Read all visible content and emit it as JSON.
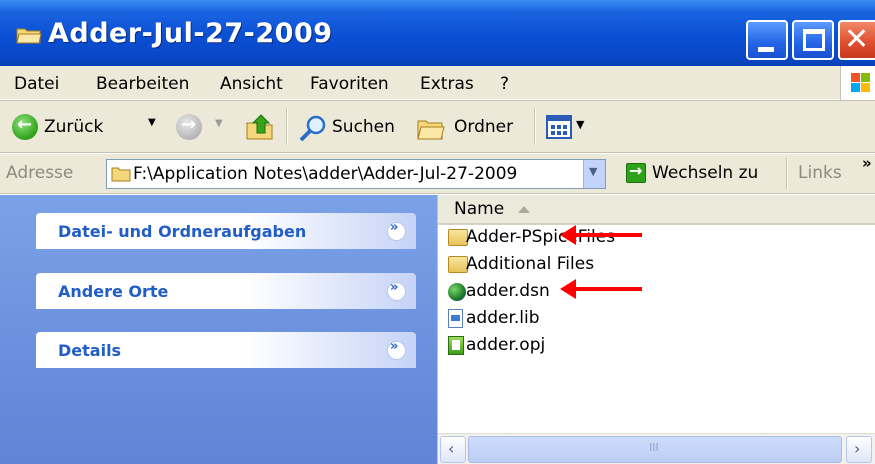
{
  "window": {
    "title": "Adder-Jul-27-2009"
  },
  "menubar": {
    "items": [
      "Datei",
      "Bearbeiten",
      "Ansicht",
      "Favoriten",
      "Extras",
      "?"
    ]
  },
  "toolbar": {
    "back_label": "Zurück",
    "search_label": "Suchen",
    "folders_label": "Ordner"
  },
  "addressbar": {
    "label": "Adresse",
    "path": "F:\\Application Notes\\adder\\Adder-Jul-27-2009",
    "go_label": "Wechseln zu",
    "links_label": "Links",
    "overflow": "»"
  },
  "taskpane": {
    "sections": [
      {
        "label": "Datei- und Ordneraufgaben"
      },
      {
        "label": "Andere Orte"
      },
      {
        "label": "Details"
      }
    ]
  },
  "filelist": {
    "column_header": "Name",
    "items": [
      {
        "name": "Adder-PSpiceFiles",
        "icon": "folder-icon",
        "highlighted": true
      },
      {
        "name": "Additional Files",
        "icon": "folder-icon",
        "highlighted": false
      },
      {
        "name": "adder.dsn",
        "icon": "design-file-icon",
        "highlighted": true
      },
      {
        "name": "adder.lib",
        "icon": "library-file-icon",
        "highlighted": false
      },
      {
        "name": "adder.opj",
        "icon": "project-file-icon",
        "highlighted": false
      }
    ]
  },
  "scrollbar": {
    "grip": "III"
  },
  "colors": {
    "titlebar": "#0a4fd4",
    "taskpane_bg": "#7ba2e7",
    "task_label": "#215dc6",
    "annotation_arrow": "#ff0000"
  }
}
